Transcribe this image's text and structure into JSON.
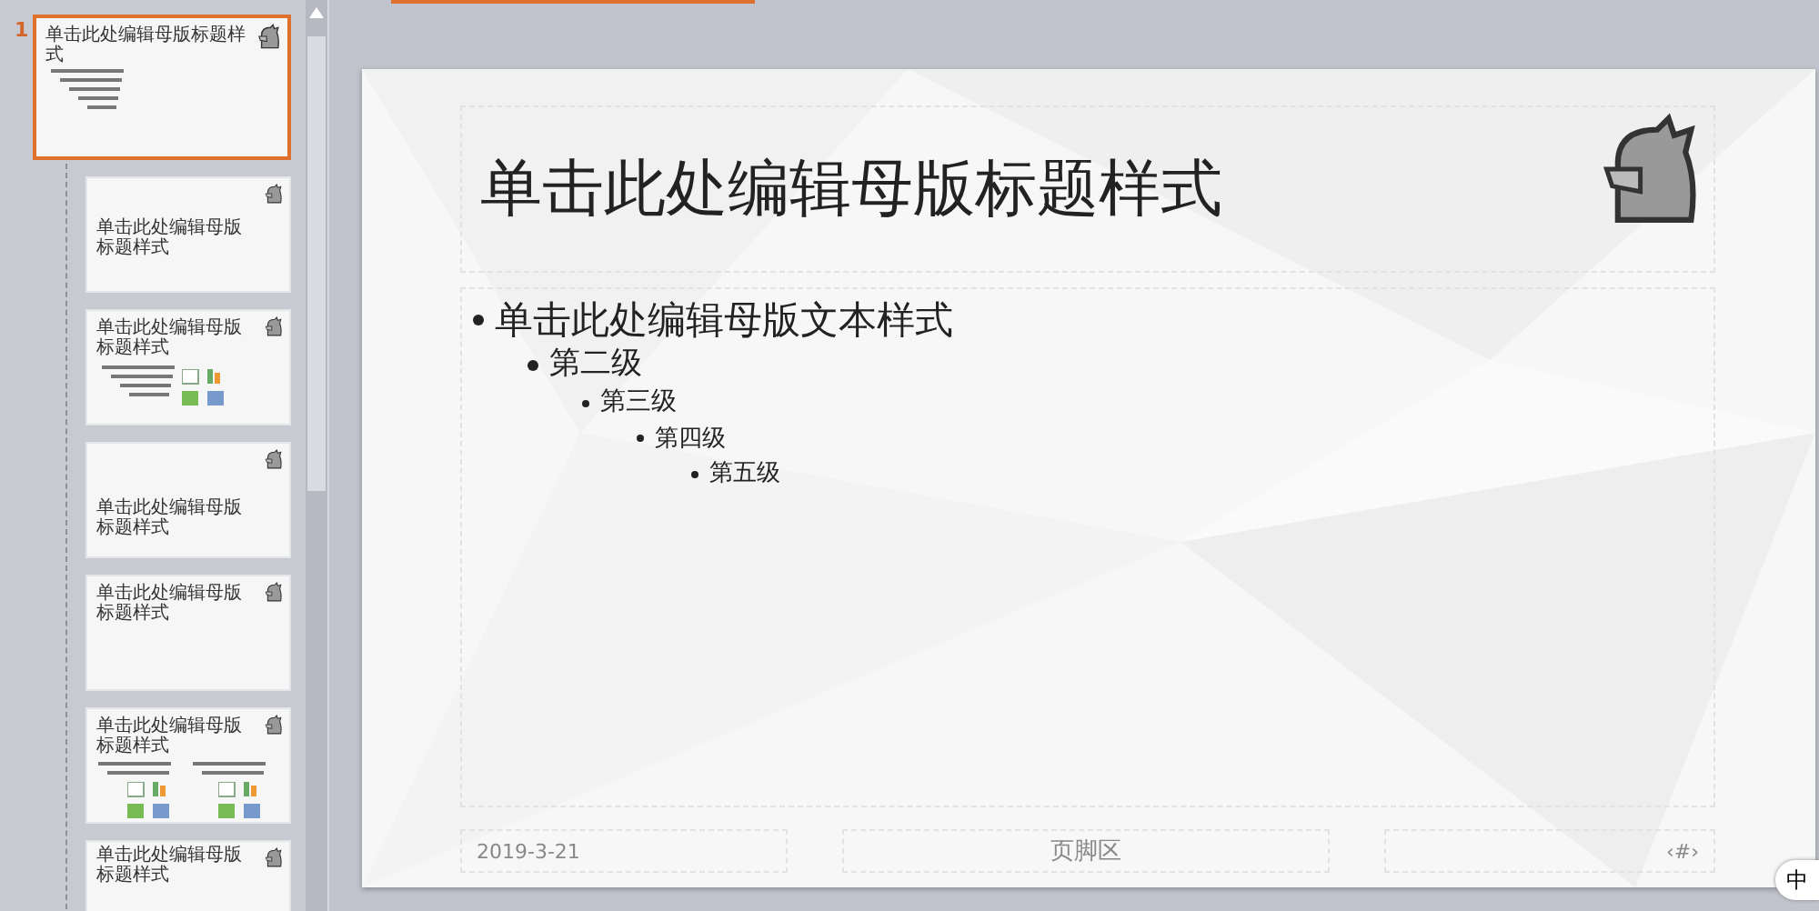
{
  "slide_panel": {
    "slide_number": "1",
    "thumbnails": [
      {
        "kind": "content",
        "title": "单击此处编辑母版标题样式",
        "selected": true
      },
      {
        "kind": "title-slide",
        "title": "单击此处编辑母版标题样式",
        "selected": false
      },
      {
        "kind": "content-icons",
        "title": "单击此处编辑母版标题样式",
        "selected": false
      },
      {
        "kind": "section",
        "title": "单击此处编辑母版标题样式",
        "selected": false
      },
      {
        "kind": "title-only",
        "title": "单击此处编辑母版标题样式",
        "selected": false
      },
      {
        "kind": "two-content",
        "title": "单击此处编辑母版标题样式",
        "selected": false
      },
      {
        "kind": "partial",
        "title": "单击此处编辑母版标题样式",
        "selected": false
      }
    ]
  },
  "slide": {
    "title": "单击此处编辑母版标题样式",
    "bullets": [
      {
        "text": "单击此处编辑母版文本样式",
        "children": [
          {
            "text": "第二级",
            "children": [
              {
                "text": "第三级",
                "children": [
                  {
                    "text": "第四级",
                    "children": [
                      {
                        "text": "第五级"
                      }
                    ]
                  }
                ]
              }
            ]
          }
        ]
      }
    ],
    "footer": {
      "date": "2019-3-21",
      "center": "页脚区",
      "number": "‹#›"
    }
  },
  "input_method": "中"
}
